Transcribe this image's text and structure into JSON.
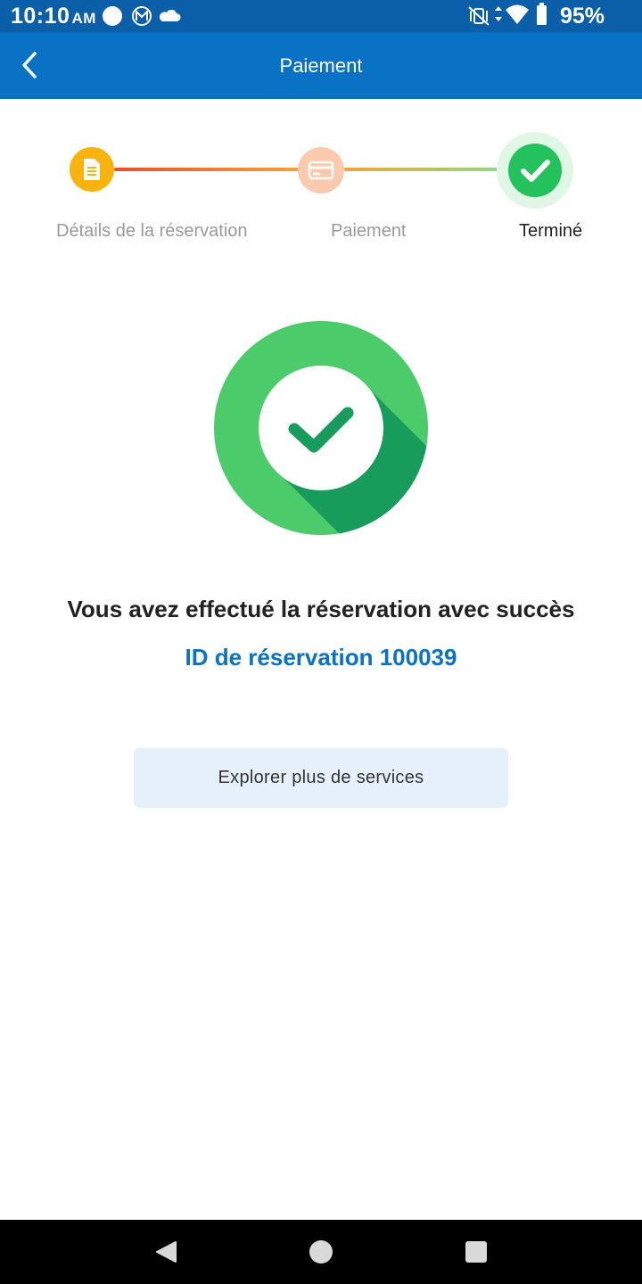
{
  "status_bar": {
    "time": "10:10",
    "ampm": "AM",
    "battery": "95%",
    "icons": [
      "circle-icon",
      "m-badge-icon",
      "cloud-icon",
      "mute-vibrate-icon",
      "data-arrows-icon",
      "wifi-icon",
      "battery-icon"
    ]
  },
  "app_bar": {
    "title": "Paiement",
    "back_icon": "chevron-left-icon"
  },
  "stepper": {
    "steps": [
      {
        "label": "Détails de la réservation",
        "icon": "document-icon",
        "color": "#f8b30e"
      },
      {
        "label": "Paiement",
        "icon": "credit-card-icon",
        "color": "#fbcaae"
      },
      {
        "label": "Terminé",
        "icon": "check-icon",
        "color": "#23c25c"
      }
    ]
  },
  "main": {
    "success_icon": "check-circle-icon",
    "success_message": "Vous avez effectué la réservation avec succès",
    "booking_id": "ID de réservation 100039",
    "explore_button": "Explorer plus de services"
  },
  "nav_bar": {
    "icons": [
      "back-triangle-icon",
      "home-circle-icon",
      "recents-square-icon"
    ]
  },
  "colors": {
    "status_bar": "#0a5fa8",
    "app_bar": "#0a72c4",
    "accent_blue": "#0a72c4",
    "success_green": "#4ccb6a",
    "success_dark_green": "#179c5c"
  }
}
